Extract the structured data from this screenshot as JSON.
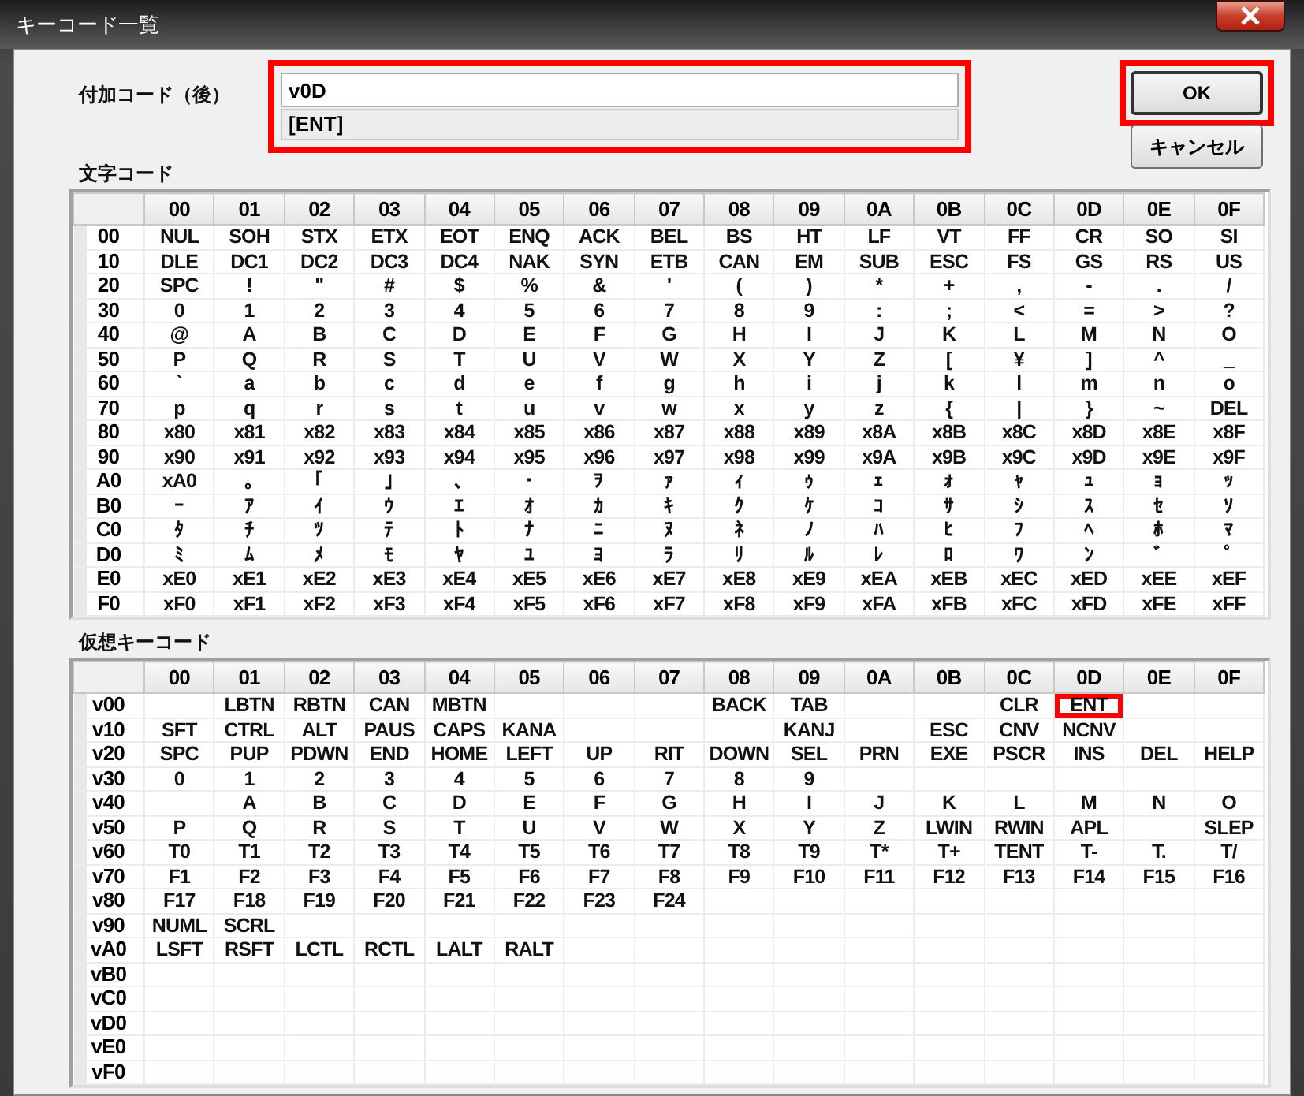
{
  "window": {
    "title": "キーコード一覧"
  },
  "suffix_code": {
    "label": "付加コード（後）",
    "value": "v0D",
    "key_name": "[ENT]",
    "highlighted": true
  },
  "buttons": [
    {
      "label": "OK",
      "default": true,
      "highlighted": true
    },
    {
      "label": "キャンセル",
      "default": false,
      "highlighted": false
    }
  ],
  "char_table": {
    "title": "文字コード",
    "columns": [
      "00",
      "01",
      "02",
      "03",
      "04",
      "05",
      "06",
      "07",
      "08",
      "09",
      "0A",
      "0B",
      "0C",
      "0D",
      "0E",
      "0F"
    ],
    "rows": [
      {
        "header": "00",
        "cells": [
          "NUL",
          "SOH",
          "STX",
          "ETX",
          "EOT",
          "ENQ",
          "ACK",
          "BEL",
          "BS",
          "HT",
          "LF",
          "VT",
          "FF",
          "CR",
          "SO",
          "SI"
        ]
      },
      {
        "header": "10",
        "cells": [
          "DLE",
          "DC1",
          "DC2",
          "DC3",
          "DC4",
          "NAK",
          "SYN",
          "ETB",
          "CAN",
          "EM",
          "SUB",
          "ESC",
          "FS",
          "GS",
          "RS",
          "US"
        ]
      },
      {
        "header": "20",
        "cells": [
          "SPC",
          "!",
          "\"",
          "#",
          "$",
          "%",
          "&",
          "'",
          "(",
          ")",
          "*",
          "+",
          ",",
          "-",
          ".",
          "/"
        ]
      },
      {
        "header": "30",
        "cells": [
          "0",
          "1",
          "2",
          "3",
          "4",
          "5",
          "6",
          "7",
          "8",
          "9",
          ":",
          ";",
          "<",
          "=",
          ">",
          "?"
        ]
      },
      {
        "header": "40",
        "cells": [
          "@",
          "A",
          "B",
          "C",
          "D",
          "E",
          "F",
          "G",
          "H",
          "I",
          "J",
          "K",
          "L",
          "M",
          "N",
          "O"
        ]
      },
      {
        "header": "50",
        "cells": [
          "P",
          "Q",
          "R",
          "S",
          "T",
          "U",
          "V",
          "W",
          "X",
          "Y",
          "Z",
          "[",
          "¥",
          "]",
          "^",
          "_"
        ]
      },
      {
        "header": "60",
        "cells": [
          "`",
          "a",
          "b",
          "c",
          "d",
          "e",
          "f",
          "g",
          "h",
          "i",
          "j",
          "k",
          "l",
          "m",
          "n",
          "o"
        ]
      },
      {
        "header": "70",
        "cells": [
          "p",
          "q",
          "r",
          "s",
          "t",
          "u",
          "v",
          "w",
          "x",
          "y",
          "z",
          "{",
          "|",
          "}",
          "~",
          "DEL"
        ]
      },
      {
        "header": "80",
        "cells": [
          "x80",
          "x81",
          "x82",
          "x83",
          "x84",
          "x85",
          "x86",
          "x87",
          "x88",
          "x89",
          "x8A",
          "x8B",
          "x8C",
          "x8D",
          "x8E",
          "x8F"
        ]
      },
      {
        "header": "90",
        "cells": [
          "x90",
          "x91",
          "x92",
          "x93",
          "x94",
          "x95",
          "x96",
          "x97",
          "x98",
          "x99",
          "x9A",
          "x9B",
          "x9C",
          "x9D",
          "x9E",
          "x9F"
        ]
      },
      {
        "header": "A0",
        "cells": [
          "xA0",
          "｡",
          "｢",
          "｣",
          "､",
          "･",
          "ｦ",
          "ｧ",
          "ｨ",
          "ｩ",
          "ｪ",
          "ｫ",
          "ｬ",
          "ｭ",
          "ｮ",
          "ｯ"
        ]
      },
      {
        "header": "B0",
        "cells": [
          "ｰ",
          "ｱ",
          "ｲ",
          "ｳ",
          "ｴ",
          "ｵ",
          "ｶ",
          "ｷ",
          "ｸ",
          "ｹ",
          "ｺ",
          "ｻ",
          "ｼ",
          "ｽ",
          "ｾ",
          "ｿ"
        ]
      },
      {
        "header": "C0",
        "cells": [
          "ﾀ",
          "ﾁ",
          "ﾂ",
          "ﾃ",
          "ﾄ",
          "ﾅ",
          "ﾆ",
          "ﾇ",
          "ﾈ",
          "ﾉ",
          "ﾊ",
          "ﾋ",
          "ﾌ",
          "ﾍ",
          "ﾎ",
          "ﾏ"
        ]
      },
      {
        "header": "D0",
        "cells": [
          "ﾐ",
          "ﾑ",
          "ﾒ",
          "ﾓ",
          "ﾔ",
          "ﾕ",
          "ﾖ",
          "ﾗ",
          "ﾘ",
          "ﾙ",
          "ﾚ",
          "ﾛ",
          "ﾜ",
          "ﾝ",
          "ﾞ",
          "ﾟ"
        ]
      },
      {
        "header": "E0",
        "cells": [
          "xE0",
          "xE1",
          "xE2",
          "xE3",
          "xE4",
          "xE5",
          "xE6",
          "xE7",
          "xE8",
          "xE9",
          "xEA",
          "xEB",
          "xEC",
          "xED",
          "xEE",
          "xEF"
        ]
      },
      {
        "header": "F0",
        "cells": [
          "xF0",
          "xF1",
          "xF2",
          "xF3",
          "xF4",
          "xF5",
          "xF6",
          "xF7",
          "xF8",
          "xF9",
          "xFA",
          "xFB",
          "xFC",
          "xFD",
          "xFE",
          "xFF"
        ]
      }
    ]
  },
  "vkey_table": {
    "title": "仮想キーコード",
    "columns": [
      "00",
      "01",
      "02",
      "03",
      "04",
      "05",
      "06",
      "07",
      "08",
      "09",
      "0A",
      "0B",
      "0C",
      "0D",
      "0E",
      "0F"
    ],
    "rows": [
      {
        "header": "v00",
        "cells": [
          "",
          "LBTN",
          "RBTN",
          "CAN",
          "MBTN",
          "",
          "",
          "",
          "BACK",
          "TAB",
          "",
          "",
          "CLR",
          {
            "text": "ENT",
            "highlighted": true
          },
          "",
          ""
        ]
      },
      {
        "header": "v10",
        "cells": [
          "SFT",
          "CTRL",
          "ALT",
          "PAUS",
          "CAPS",
          "KANA",
          "",
          "",
          "",
          "KANJ",
          "",
          "ESC",
          "CNV",
          "NCNV",
          "",
          ""
        ]
      },
      {
        "header": "v20",
        "cells": [
          "SPC",
          "PUP",
          "PDWN",
          "END",
          "HOME",
          "LEFT",
          "UP",
          "RIT",
          "DOWN",
          "SEL",
          "PRN",
          "EXE",
          "PSCR",
          "INS",
          "DEL",
          "HELP"
        ]
      },
      {
        "header": "v30",
        "cells": [
          "0",
          "1",
          "2",
          "3",
          "4",
          "5",
          "6",
          "7",
          "8",
          "9",
          "",
          "",
          "",
          "",
          "",
          ""
        ]
      },
      {
        "header": "v40",
        "cells": [
          "",
          "A",
          "B",
          "C",
          "D",
          "E",
          "F",
          "G",
          "H",
          "I",
          "J",
          "K",
          "L",
          "M",
          "N",
          "O"
        ]
      },
      {
        "header": "v50",
        "cells": [
          "P",
          "Q",
          "R",
          "S",
          "T",
          "U",
          "V",
          "W",
          "X",
          "Y",
          "Z",
          "LWIN",
          "RWIN",
          "APL",
          "",
          "SLEP"
        ]
      },
      {
        "header": "v60",
        "cells": [
          "T0",
          "T1",
          "T2",
          "T3",
          "T4",
          "T5",
          "T6",
          "T7",
          "T8",
          "T9",
          "T*",
          "T+",
          "TENT",
          "T-",
          "T.",
          "T/"
        ]
      },
      {
        "header": "v70",
        "cells": [
          "F1",
          "F2",
          "F3",
          "F4",
          "F5",
          "F6",
          "F7",
          "F8",
          "F9",
          "F10",
          "F11",
          "F12",
          "F13",
          "F14",
          "F15",
          "F16"
        ]
      },
      {
        "header": "v80",
        "cells": [
          "F17",
          "F18",
          "F19",
          "F20",
          "F21",
          "F22",
          "F23",
          "F24",
          "",
          "",
          "",
          "",
          "",
          "",
          "",
          ""
        ]
      },
      {
        "header": "v90",
        "cells": [
          "NUML",
          "SCRL",
          "",
          "",
          "",
          "",
          "",
          "",
          "",
          "",
          "",
          "",
          "",
          "",
          "",
          ""
        ]
      },
      {
        "header": "vA0",
        "cells": [
          "LSFT",
          "RSFT",
          "LCTL",
          "RCTL",
          "LALT",
          "RALT",
          "",
          "",
          "",
          "",
          "",
          "",
          "",
          "",
          "",
          ""
        ]
      },
      {
        "header": "vB0",
        "cells": [
          "",
          "",
          "",
          "",
          "",
          "",
          "",
          "",
          "",
          "",
          "",
          "",
          "",
          "",
          "",
          ""
        ]
      },
      {
        "header": "vC0",
        "cells": [
          "",
          "",
          "",
          "",
          "",
          "",
          "",
          "",
          "",
          "",
          "",
          "",
          "",
          "",
          "",
          ""
        ]
      },
      {
        "header": "vD0",
        "cells": [
          "",
          "",
          "",
          "",
          "",
          "",
          "",
          "",
          "",
          "",
          "",
          "",
          "",
          "",
          "",
          ""
        ]
      },
      {
        "header": "vE0",
        "cells": [
          "",
          "",
          "",
          "",
          "",
          "",
          "",
          "",
          "",
          "",
          "",
          "",
          "",
          "",
          "",
          ""
        ]
      },
      {
        "header": "vF0",
        "cells": [
          "",
          "",
          "",
          "",
          "",
          "",
          "",
          "",
          "",
          "",
          "",
          "",
          "",
          "",
          "",
          ""
        ]
      }
    ]
  }
}
